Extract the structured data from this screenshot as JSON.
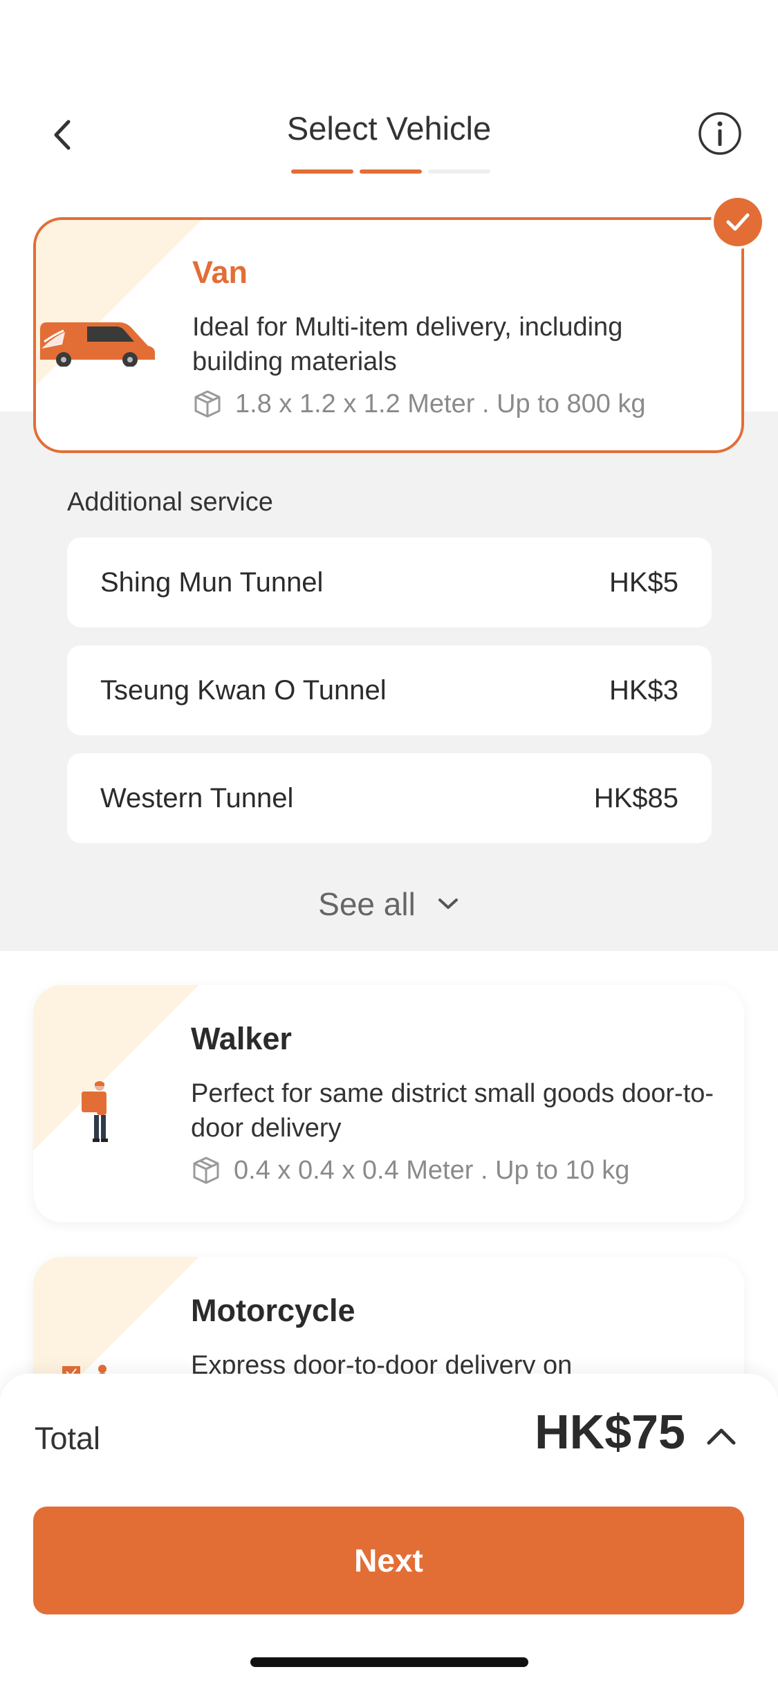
{
  "header": {
    "title": "Select Vehicle",
    "steps_total": 3,
    "steps_completed": 2
  },
  "selected_vehicle": {
    "name": "Van",
    "description": "Ideal for Multi-item delivery, including building materials",
    "spec": "1.8 x 1.2 x 1.2 Meter . Up to 800 kg",
    "icon": "van-icon"
  },
  "additional_service": {
    "title": "Additional service",
    "items": [
      {
        "name": "Shing Mun Tunnel",
        "price": "HK$5"
      },
      {
        "name": "Tseung Kwan O Tunnel",
        "price": "HK$3"
      },
      {
        "name": "Western Tunnel",
        "price": "HK$85"
      }
    ],
    "see_all_label": "See all"
  },
  "vehicles": [
    {
      "name": "Walker",
      "description": "Perfect for same district small goods door-to-door delivery",
      "spec": "0.4 x 0.4 x 0.4 Meter . Up to 10 kg",
      "icon": "walker-icon"
    },
    {
      "name": "Motorcycle",
      "description": "Express door-to-door delivery on",
      "icon": "motorcycle-icon"
    }
  ],
  "footer": {
    "total_label": "Total",
    "total_value": "HK$75",
    "next_label": "Next"
  },
  "colors": {
    "accent": "#e26e36",
    "corner": "#fdf3e0",
    "background_gray": "#f2f2f2"
  }
}
